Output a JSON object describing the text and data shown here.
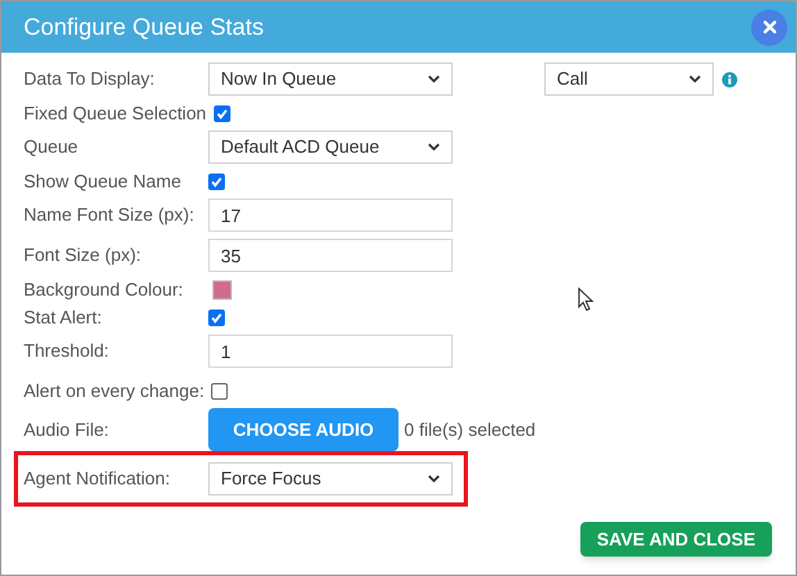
{
  "dialog": {
    "title": "Configure Queue Stats"
  },
  "rows": [
    {
      "kind": "select",
      "label": "Data To Display:",
      "value": "Now In Queue",
      "extra_select": {
        "value": "Call"
      }
    },
    {
      "kind": "checkbox",
      "label": "Fixed Queue Selection",
      "checked": true
    },
    {
      "kind": "select",
      "label": "Queue",
      "value": "Default ACD Queue"
    },
    {
      "kind": "checkbox",
      "label": "Show Queue Name",
      "checked": true
    },
    {
      "kind": "text",
      "label": "Name Font Size (px):",
      "value": "17"
    },
    {
      "kind": "text",
      "label": "Font Size (px):",
      "value": "35"
    },
    {
      "kind": "color",
      "label": "Background Colour:",
      "color": "#d06d8c"
    },
    {
      "kind": "checkbox",
      "label": "Stat Alert:",
      "checked": true
    },
    {
      "kind": "text",
      "label": "Threshold:",
      "value": "1"
    },
    {
      "kind": "checkbox",
      "label": "Alert on every change:",
      "checked": false
    },
    {
      "kind": "file",
      "label": "Audio File:",
      "button": "CHOOSE AUDIO",
      "status": "0 file(s) selected"
    },
    {
      "kind": "select",
      "label": "Agent Notification:",
      "value": "Force Focus",
      "highlighted": true
    }
  ],
  "footer": {
    "button": "SAVE AND CLOSE"
  }
}
